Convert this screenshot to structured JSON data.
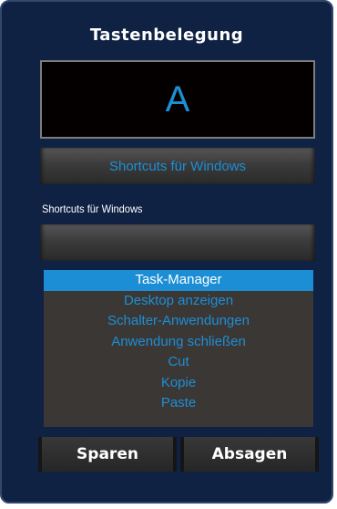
{
  "title": "Tastenbelegung",
  "key_display": "A",
  "dropdown": {
    "selected": "Shortcuts für Windows"
  },
  "section_label": "Shortcuts für Windows",
  "input": {
    "value": ""
  },
  "list": {
    "items": [
      "Task-Manager",
      "Desktop anzeigen",
      "Schalter-Anwendungen",
      "Anwendung schließen",
      "Cut",
      "Kopie",
      "Paste"
    ],
    "selected_index": 0
  },
  "buttons": {
    "save": "Sparen",
    "cancel": "Absagen"
  },
  "colors": {
    "accent": "#1c8fd6",
    "panel": "#0f2244",
    "list_bg": "#3b3735"
  }
}
